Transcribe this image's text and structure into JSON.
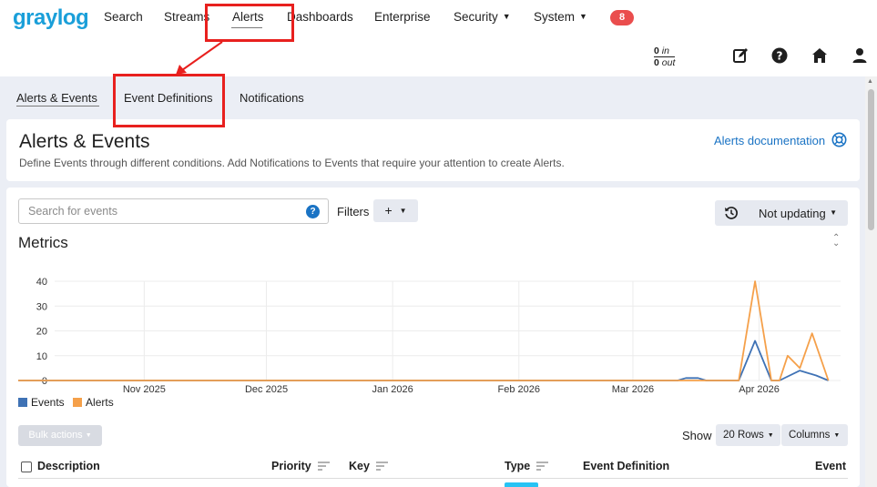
{
  "nav": {
    "logo": "graylog",
    "items": [
      {
        "label": "Search",
        "caret": false
      },
      {
        "label": "Streams",
        "caret": false
      },
      {
        "label": "Alerts",
        "caret": false
      },
      {
        "label": "Dashboards",
        "caret": false
      },
      {
        "label": "Enterprise",
        "caret": false
      },
      {
        "label": "Security",
        "caret": true
      },
      {
        "label": "System",
        "caret": true
      }
    ],
    "notification_count": "8",
    "throughput": {
      "in_value": "0",
      "in_label": "in",
      "out_value": "0",
      "out_label": "out"
    },
    "icons": [
      "edit-icon",
      "help-icon",
      "home-icon",
      "user-icon"
    ]
  },
  "subnav": {
    "items": [
      "Alerts & Events",
      "Event Definitions",
      "Notifications"
    ]
  },
  "header": {
    "title": "Alerts & Events",
    "description": "Define Events through different conditions. Add Notifications to Events that require your attention to create Alerts.",
    "doc_link": "Alerts documentation"
  },
  "search": {
    "placeholder": "Search for events",
    "help": "?",
    "filters_label": "Filters",
    "add_filter": "+",
    "refresh_label": "Not updating"
  },
  "metrics": {
    "title": "Metrics"
  },
  "chart_data": {
    "type": "line",
    "x_tick_labels": [
      "Nov 2025",
      "Dec 2025",
      "Jan 2026",
      "Feb 2026",
      "Mar 2026",
      "Apr 2026"
    ],
    "y_tick_labels": [
      "0",
      "10",
      "20",
      "30",
      "40"
    ],
    "ylim": [
      0,
      40
    ],
    "grid": true,
    "legend_position": "bottom-left",
    "series": [
      {
        "name": "Events",
        "color": "#3f72b5",
        "points": [
          [
            "2025-10-01",
            0
          ],
          [
            "2026-03-12",
            0
          ],
          [
            "2026-03-14",
            1
          ],
          [
            "2026-03-17",
            1
          ],
          [
            "2026-03-19",
            0
          ],
          [
            "2026-03-27",
            0
          ],
          [
            "2026-03-31",
            16
          ],
          [
            "2026-04-04",
            0
          ],
          [
            "2026-04-06",
            0
          ],
          [
            "2026-04-11",
            4
          ],
          [
            "2026-04-15",
            2
          ],
          [
            "2026-04-18",
            0
          ]
        ]
      },
      {
        "name": "Alerts",
        "color": "#f5a04a",
        "points": [
          [
            "2025-10-01",
            0
          ],
          [
            "2026-03-27",
            0
          ],
          [
            "2026-03-31",
            40
          ],
          [
            "2026-04-04",
            0
          ],
          [
            "2026-04-06",
            0
          ],
          [
            "2026-04-08",
            10
          ],
          [
            "2026-04-11",
            5
          ],
          [
            "2026-04-14",
            19
          ],
          [
            "2026-04-18",
            0
          ]
        ]
      }
    ]
  },
  "table": {
    "bulk_actions": "Bulk actions",
    "show_label": "Show",
    "rows_option": "20 Rows",
    "columns_label": "Columns",
    "headers": [
      "Description",
      "Priority",
      "Key",
      "Type",
      "Event Definition",
      "Event"
    ]
  }
}
